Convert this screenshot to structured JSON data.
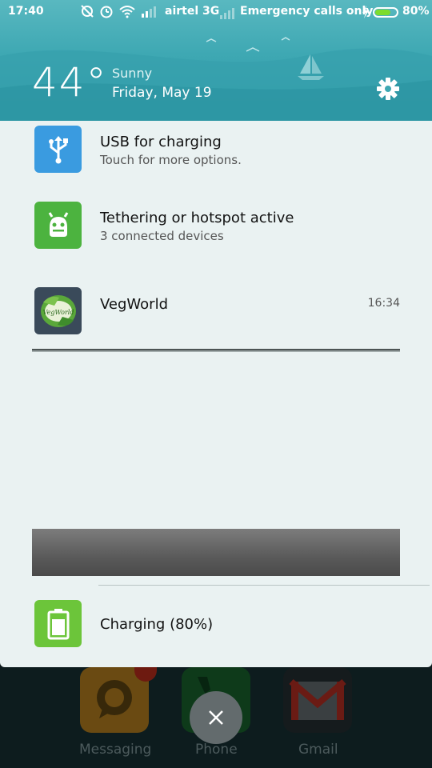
{
  "status_bar": {
    "time": "17:40",
    "carrier": "airtel 3G",
    "emergency": "Emergency calls only",
    "battery_percent": "80%",
    "battery_level": 0.8,
    "icons": [
      "sync-off-icon",
      "alarm-icon",
      "wifi-icon",
      "signal-icon",
      "signal-weak-icon",
      "charging-bolt-icon",
      "battery-icon"
    ]
  },
  "weather": {
    "temperature": "44°",
    "condition": "Sunny",
    "date": "Friday, May 19"
  },
  "notifications": [
    {
      "title": "USB for charging",
      "subtitle": "Touch for more options.",
      "icon": "usb-icon",
      "icon_color": "#3a9be0"
    },
    {
      "title": "Tethering or hotspot active",
      "subtitle": "3 connected devices",
      "icon": "android-icon",
      "icon_color": "#4cb33f"
    },
    {
      "title": "VegWorld",
      "time": "16:34",
      "icon": "vegworld-app-icon",
      "icon_color": "#3a4a5a",
      "icon_text": "VegWorld"
    },
    {
      "title": "Charging (80%)",
      "icon": "battery-charging-icon",
      "icon_color": "#6cc53a"
    }
  ],
  "launcher": {
    "apps": [
      {
        "label": "Messaging",
        "icon": "messaging-icon"
      },
      {
        "label": "Phone",
        "icon": "phone-icon"
      },
      {
        "label": "Gmail",
        "icon": "gmail-icon"
      }
    ]
  },
  "close_button": {
    "icon": "close-icon"
  },
  "colors": {
    "header_bg": "#3ea8b3",
    "panel_bg": "#eaf2f2"
  }
}
